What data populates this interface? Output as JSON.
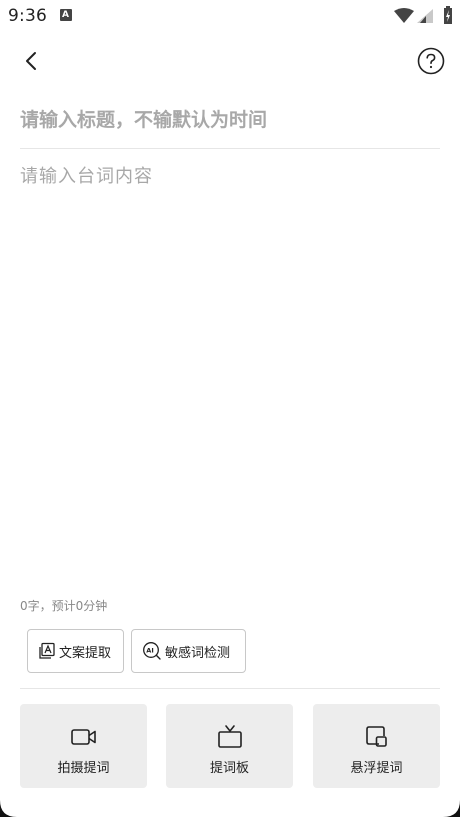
{
  "status_bar": {
    "time": "9:36",
    "notification_icon": "a-box-icon",
    "wifi_icon": "wifi-icon",
    "signal_icon": "signal-icon",
    "battery_icon": "battery-charging-icon"
  },
  "top_bar": {
    "back_icon": "chevron-left-icon",
    "help_icon": "question-circle-icon"
  },
  "editor": {
    "title_placeholder": "请输入标题，不输默认为时间",
    "title_value": "",
    "content_placeholder": "请输入台词内容",
    "content_value": "",
    "word_count": "0字，预计0分钟"
  },
  "tools": {
    "extract_label": "文案提取",
    "detect_label": "敏感词检测"
  },
  "actions": {
    "shoot_label": "拍摄提词",
    "board_label": "提词板",
    "float_label": "悬浮提词"
  },
  "colors": {
    "placeholder": "#a8a8a8",
    "divider": "#e6e6e6",
    "action_bg": "#ededed",
    "text": "#222222"
  }
}
